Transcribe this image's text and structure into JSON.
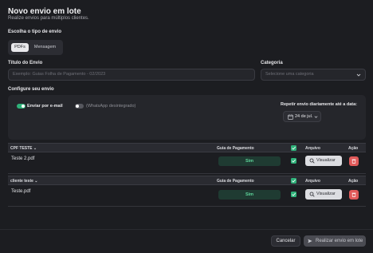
{
  "header": {
    "title": "Novo envio em lote",
    "subtitle": "Realize envios para múltiplos clientes."
  },
  "send_type": {
    "label": "Escolha o tipo de envio",
    "options": [
      "PDFs",
      "Mensagem"
    ],
    "selected": "PDFs"
  },
  "form": {
    "title_label": "Título do Envio",
    "title_placeholder": "Exemplo: Guias Folha de Pagamento - 02/2023",
    "category_label": "Categoria",
    "category_placeholder": "Selecione uma categoria"
  },
  "configure": {
    "label": "Configure seu envio",
    "email_toggle_label": "Enviar por e-mail",
    "email_toggle_on": true,
    "whatsapp_toggle_label": "(WhatsApp desintegrado)",
    "whatsapp_toggle_on": false,
    "repeat_label": "Repetir envio diariamente até a data:",
    "repeat_date": "24 de jul."
  },
  "tables": [
    {
      "name_header": "CPF TESTE",
      "columns": [
        "Guia de Pagamento",
        "Arquivo",
        "Ação"
      ],
      "rows": [
        {
          "file": "Teste 2.pdf",
          "guia": "Sim",
          "checked": true,
          "view_label": "Visualizar"
        }
      ]
    },
    {
      "name_header": "cliente teste",
      "columns": [
        "Guia de Pagamento",
        "Arquivo",
        "Ação"
      ],
      "rows": [
        {
          "file": "Teste.pdf",
          "guia": "Sim",
          "checked": true,
          "view_label": "Visualizar"
        }
      ]
    }
  ],
  "footer": {
    "cancel_label": "Cancelar",
    "submit_label": "Realizar envio em lote"
  },
  "colors": {
    "background": "#1c1d21",
    "accent_green": "#2fb27a",
    "delete_red": "#e05a5a"
  },
  "icons": [
    "calendar-icon",
    "chevron-down-icon",
    "magnifier-icon",
    "trash-icon",
    "send-icon",
    "check-icon",
    "sort-chevron-icon"
  ]
}
